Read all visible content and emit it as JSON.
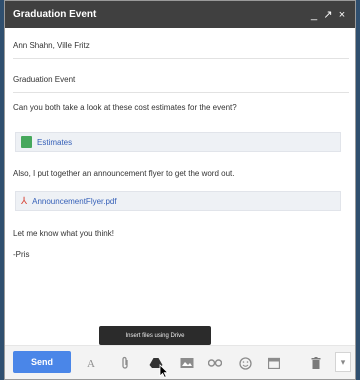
{
  "window": {
    "title": "Graduation Event",
    "minimize_label": "_",
    "popout_label": "↗",
    "close_label": "×"
  },
  "compose": {
    "to": "Ann Shahn, Ville Fritz",
    "subject": "Graduation Event",
    "body_line_1": "Can you both take a look at these cost estimates for the event?",
    "attachment_1": "Estimates",
    "body_line_2": "Also, I put together an announcement flyer to get the word out.",
    "attachment_2": "AnnouncementFlyer.pdf",
    "body_line_3": "Let me know what you think!",
    "signature": "-Pris"
  },
  "tooltip": "Insert files using Drive",
  "toolbar": {
    "send_label": "Send",
    "icons": [
      "text-format-icon",
      "attach-icon",
      "drive-icon",
      "photo-icon",
      "link-icon",
      "emoji-icon",
      "calendar-icon",
      "trash-icon",
      "more-options-icon"
    ]
  },
  "colors": {
    "title_bar": "#404040",
    "send_button": "#4a86e8",
    "link": "#3560b8",
    "sheets_green": "#46a85c",
    "pdf_red": "#d8493b",
    "tooltip_bg": "#2b2b2b"
  }
}
